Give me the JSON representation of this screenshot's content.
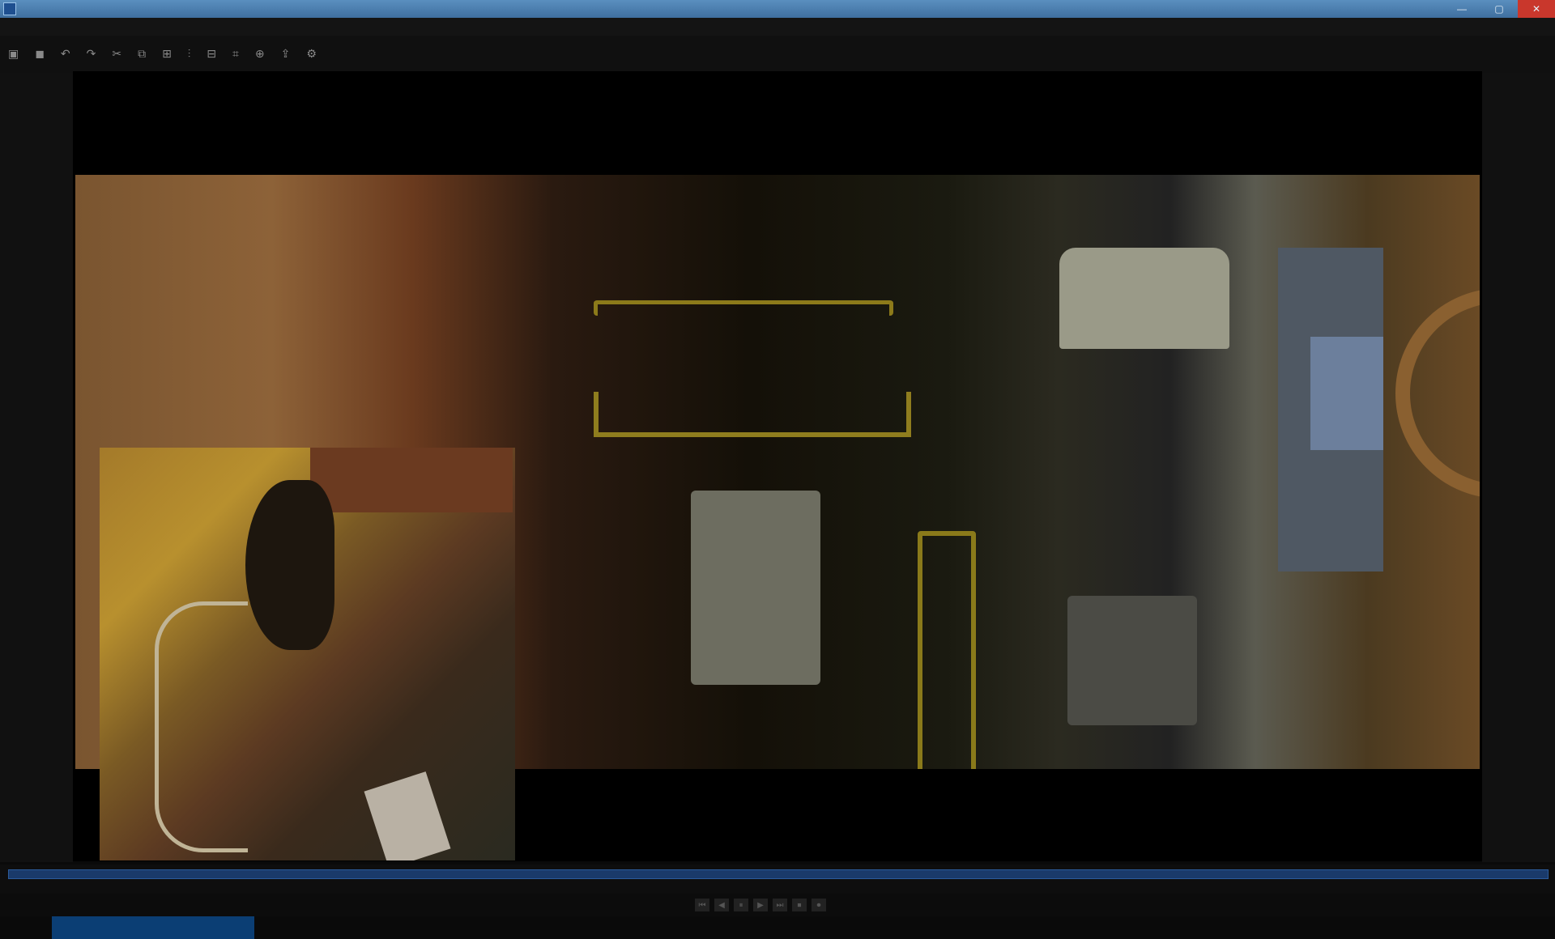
{
  "window": {
    "title": "",
    "buttons": {
      "min": "—",
      "max": "▢",
      "close": "✕"
    }
  },
  "menus": [
    "",
    "",
    "",
    "",
    ""
  ],
  "toolbar": [
    {
      "icon": "folder-icon",
      "label": ""
    },
    {
      "icon": "save-icon",
      "label": ""
    },
    {
      "icon": "undo-icon",
      "label": ""
    },
    {
      "icon": "redo-icon",
      "label": ""
    },
    {
      "icon": "cut-icon",
      "label": ""
    },
    {
      "icon": "copy-icon",
      "label": ""
    },
    {
      "icon": "paste-icon",
      "label": ""
    },
    {
      "icon": "split-icon",
      "label": ""
    },
    {
      "icon": "trim-icon",
      "label": ""
    },
    {
      "icon": "crop-icon",
      "label": ""
    },
    {
      "icon": "zoom-icon",
      "label": ""
    },
    {
      "icon": "export-icon",
      "label": ""
    },
    {
      "icon": "settings-icon",
      "label": ""
    }
  ],
  "timeline": {
    "ticks": [
      "",
      "",
      "",
      "",
      "",
      "",
      "",
      "",
      "",
      "",
      "",
      ""
    ]
  },
  "transport": {
    "timecode": "",
    "right1": "",
    "right2": "",
    "controls": [
      "⏮",
      "◀",
      "⏸",
      "▶",
      "⏭",
      "⏹",
      "⏺"
    ]
  },
  "status": {
    "tab1": "",
    "tab2": "",
    "active": ""
  }
}
